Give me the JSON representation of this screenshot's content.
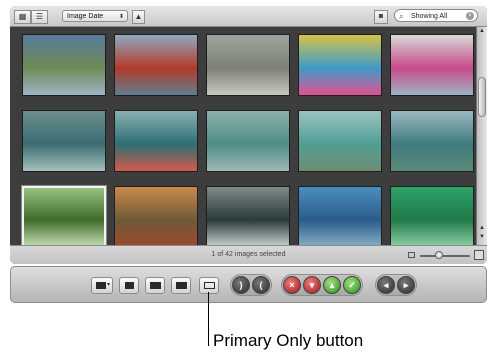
{
  "browser": {
    "sort_select": {
      "value": "Image Date"
    },
    "search": {
      "value": "Showing All"
    },
    "status_text": "1 of 42 images selected",
    "thumbnails": [
      {
        "colors": [
          "#5a7b9e",
          "#6f8a54",
          "#9fb3c6"
        ]
      },
      {
        "colors": [
          "#8fa9c2",
          "#b23a2a",
          "#5f7f8f"
        ]
      },
      {
        "colors": [
          "#9fa49c",
          "#7c8177",
          "#c8c8c2"
        ]
      },
      {
        "colors": [
          "#d7c24a",
          "#3e9bc7",
          "#e0508f"
        ]
      },
      {
        "colors": [
          "#d8d8d8",
          "#c74a8a",
          "#9fb3c6"
        ]
      },
      {
        "colors": [
          "#6c8e8a",
          "#3b6d73",
          "#a5c0bc"
        ]
      },
      {
        "colors": [
          "#8ab0b2",
          "#2d6f74",
          "#d15a4a"
        ]
      },
      {
        "colors": [
          "#8fb0ad",
          "#4f8c86",
          "#9fb9b4"
        ]
      },
      {
        "colors": [
          "#9cc3bf",
          "#4f9e93",
          "#6f8c72"
        ]
      },
      {
        "colors": [
          "#9bb8c0",
          "#3f7c7f",
          "#5a8a78"
        ]
      },
      {
        "colors": [
          "#96c27f",
          "#3e6b2a",
          "#c4dbb0"
        ]
      },
      {
        "colors": [
          "#c98a4a",
          "#6f5a3c",
          "#9c4a2a"
        ]
      },
      {
        "colors": [
          "#7f8a88",
          "#2a3a3a",
          "#c8d7d2"
        ]
      },
      {
        "colors": [
          "#4a8fc0",
          "#2a5b8a",
          "#8ab0c8"
        ]
      },
      {
        "colors": [
          "#2fa36a",
          "#1f7a48",
          "#8fd0a8"
        ]
      }
    ],
    "selected_index": 10
  },
  "toolbar": {
    "buttons": [
      "view-options",
      "stack",
      "secondary",
      "dual",
      "primary-only",
      "rotate-left",
      "rotate-right",
      "reject",
      "decrease-rating",
      "increase-rating",
      "select",
      "previous",
      "next"
    ]
  },
  "callout": {
    "label": "Primary Only button"
  }
}
